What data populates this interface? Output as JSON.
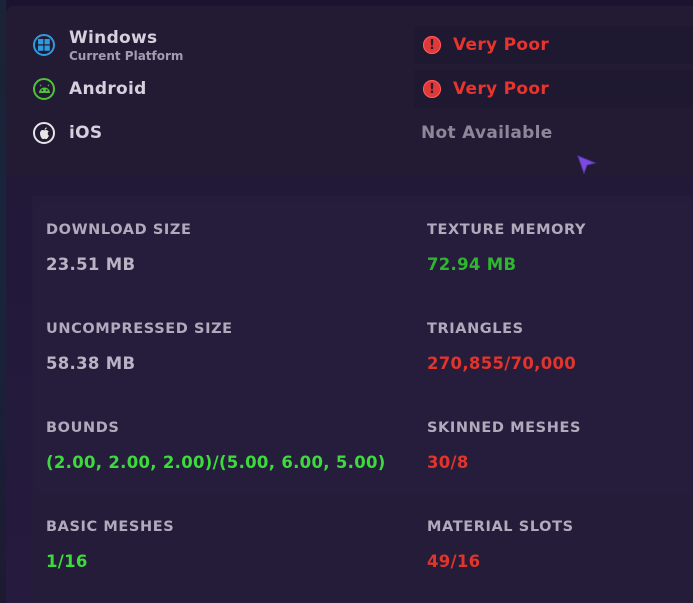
{
  "colors": {
    "windows_icon": "#2f9bde",
    "android_icon": "#4fc13a",
    "ios_icon": "#e6e6e6",
    "status_red": "#e8342c",
    "value_gray": "#b9b3c3",
    "value_green": "#2fb52f",
    "value_bright_green": "#3cdb3c",
    "cursor": "#7b4be0"
  },
  "platforms": [
    {
      "name": "Windows",
      "subtitle": "Current Platform",
      "icon": "windows-icon",
      "status": "Very Poor",
      "status_icon": "exclamation-icon"
    },
    {
      "name": "Android",
      "icon": "android-icon",
      "status": "Very Poor",
      "status_icon": "exclamation-icon"
    },
    {
      "name": "iOS",
      "icon": "apple-icon",
      "status": "Not Available"
    }
  ],
  "stats": {
    "download_size": {
      "label": "DOWNLOAD SIZE",
      "value": "23.51 MB",
      "tone": "gray"
    },
    "texture_memory": {
      "label": "TEXTURE MEMORY",
      "value": "72.94 MB",
      "tone": "green"
    },
    "uncompressed_size": {
      "label": "UNCOMPRESSED SIZE",
      "value": "58.38 MB",
      "tone": "gray"
    },
    "triangles": {
      "label": "TRIANGLES",
      "value": "270,855/70,000",
      "tone": "red"
    },
    "bounds": {
      "label": "BOUNDS",
      "value": "(2.00, 2.00, 2.00)/(5.00, 6.00, 5.00)",
      "tone": "bright-green"
    },
    "skinned_meshes": {
      "label": "SKINNED MESHES",
      "value": "30/8",
      "tone": "red"
    },
    "basic_meshes": {
      "label": "BASIC MESHES",
      "value": "1/16",
      "tone": "bright-green"
    },
    "material_slots": {
      "label": "MATERIAL SLOTS",
      "value": "49/16",
      "tone": "red"
    }
  }
}
